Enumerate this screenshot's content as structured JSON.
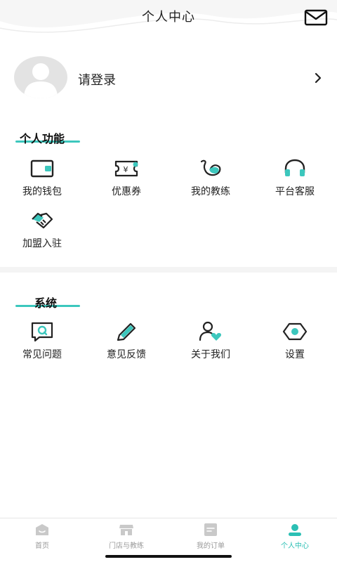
{
  "header": {
    "title": "个人中心",
    "mail_icon": "mail-icon"
  },
  "profile": {
    "login_text": "请登录",
    "avatar_icon": "default-avatar-icon",
    "chevron_icon": "chevron-right-icon"
  },
  "personal": {
    "title": "个人功能",
    "items": [
      {
        "label": "我的钱包",
        "icon": "wallet-icon"
      },
      {
        "label": "优惠券",
        "icon": "coupon-icon"
      },
      {
        "label": "我的教练",
        "icon": "muscle-arm-icon"
      },
      {
        "label": "平台客服",
        "icon": "headset-icon"
      },
      {
        "label": "加盟入驻",
        "icon": "handshake-icon"
      }
    ]
  },
  "system": {
    "title": "系统",
    "items": [
      {
        "label": "常见问题",
        "icon": "faq-chat-icon"
      },
      {
        "label": "意见反馈",
        "icon": "pencil-icon"
      },
      {
        "label": "关于我们",
        "icon": "user-heart-icon"
      },
      {
        "label": "设置",
        "icon": "settings-hex-icon"
      }
    ]
  },
  "tabbar": {
    "items": [
      {
        "label": "首页",
        "icon": "home-icon",
        "active": false
      },
      {
        "label": "门店与教练",
        "icon": "store-icon",
        "active": false
      },
      {
        "label": "我的订单",
        "icon": "order-icon",
        "active": false
      },
      {
        "label": "个人中心",
        "icon": "profile-icon",
        "active": true
      }
    ]
  },
  "colors": {
    "accent": "#3cc7bd",
    "inactive": "#9a9a9a",
    "text": "#222222"
  }
}
